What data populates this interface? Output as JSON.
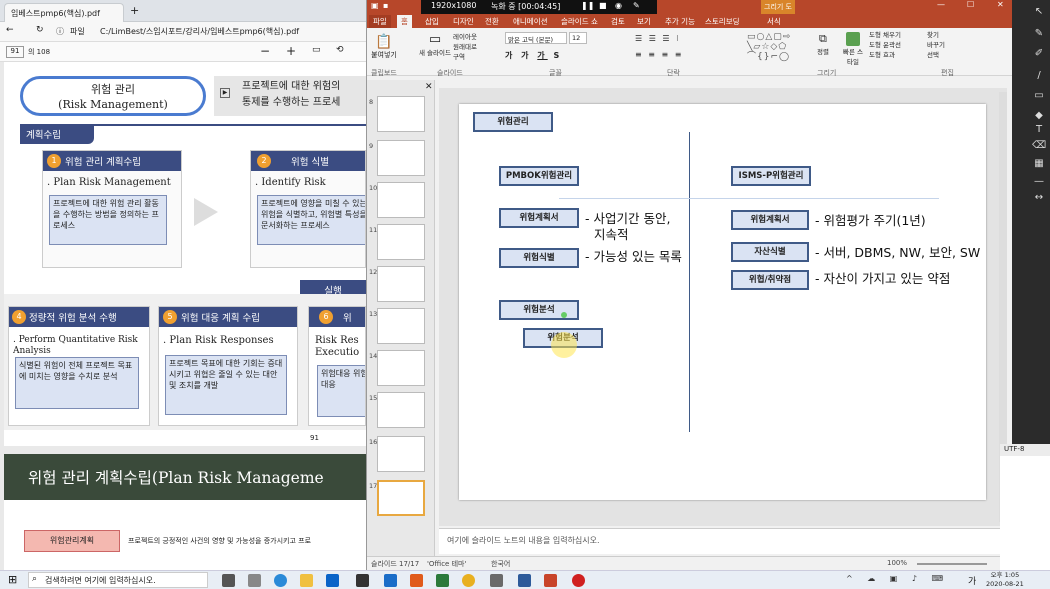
{
  "pdf": {
    "tab_title": "임베스트pmp6(핵심).pdf",
    "address_label": "파일",
    "address_path": "C:/LimBest/스임시포트/강리사/임베스트pmp6(핵심).pdf",
    "page_current": "91",
    "page_total": "의 108",
    "top_title": "위험 관리",
    "top_title_en": "(Risk Management)",
    "top_desc_line1": "프로젝트에 대한 위험의",
    "top_desc_line2": "통제를 수행하는 프로세",
    "badge_plan": "계획수립",
    "p1_header": "위험 관리 계획수립",
    "p1_num": "1",
    "p1_sub": ". Plan Risk Management",
    "p1_body": "프로젝트에 대한 위험 관리 활동을 수행하는 방법을 정의하는 프로세스",
    "p2_header": "위험 식별",
    "p2_num": "2",
    "p2_sub": ". Identify Risk",
    "p2_body": "프로젝트에 영향을 미칠 수 있는 위험을 식별하고, 위험별 특성을 문서화하는 프로세스",
    "badge_exec": "실행",
    "p4_header": "정량적 위험 분석 수행",
    "p4_num": "4",
    "p4_sub": ". Perform Quantitative Risk Analysis",
    "p4_body": "식별된 위험이 전체 프로젝트 목표에 미치는 영향을 수치로 분석",
    "p5_header": "위험 대응 계획 수립",
    "p5_num": "5",
    "p5_sub": ". Plan Risk Responses",
    "p5_body": "프로젝트 목표에 대한 기회는 증대시키고 위협은 줄일 수 있는 대안 및 조치를 개발",
    "p6_header": "위",
    "p6_num": "6",
    "p6_sub": "Risk Res Executio",
    "p6_body": "위험대응 위험대응",
    "page_number": "91",
    "next_title": "위험 관리 계획수립(Plan Risk Manageme",
    "next_badge": "위험관리계획",
    "next_desc": "프로젝트의 긍정적인 사건의 영향 및 가능성을 증가시키고 프로"
  },
  "ppt": {
    "resolution": "1920x1080",
    "recording": "녹화 중 [00:04:45]",
    "context_tab": "그리기 도구",
    "tabs": [
      "파일",
      "홈",
      "삽입",
      "디자인",
      "전환",
      "애니메이션",
      "슬라이드 쇼",
      "검토",
      "보기",
      "추가 기능",
      "스토리보딩",
      "서식"
    ],
    "groups": [
      "클립보드",
      "슬라이드",
      "글꼴",
      "단락",
      "그리기",
      "편집"
    ],
    "font_name": "맑은 고딕 (본문)",
    "font_size": "12",
    "ribbon_new_slide": "새 슬라이드",
    "ribbon_layout": "레이아웃",
    "ribbon_reset": "원래대로",
    "ribbon_section": "구역",
    "ribbon_paste": "붙여넣기",
    "ribbon_arrange": "정렬",
    "ribbon_quickstyle": "빠른 스타일",
    "ribbon_fill": "도형 채우기",
    "ribbon_outline": "도형 윤곽선",
    "ribbon_effect": "도형 효과",
    "ribbon_find": "찾기",
    "ribbon_replace": "바꾸기",
    "ribbon_select": "선택",
    "thumb_numbers": [
      "8",
      "9",
      "10",
      "11",
      "12",
      "13",
      "14",
      "15",
      "16",
      "17"
    ],
    "slide": {
      "title_box": "위험관리",
      "left_header": "PMBOK위험관리",
      "right_header": "ISMS-P위험관리",
      "l1_box": "위험계획서",
      "l1_text": "- 사업기간 동안,",
      "l1_text2": "지속적",
      "l2_box": "위험식별",
      "l2_text": "- 가능성 있는 목록",
      "l3_box": "위험분석",
      "l4_box": "위험분석",
      "r1_box": "위험계획서",
      "r1_text": "- 위험평가 주기(1년)",
      "r2_box": "자산식별",
      "r2_text": "- 서버, DBMS, NW, 보안, SW",
      "r3_box": "위협/취약점",
      "r3_text": "- 자산이 가지고 있는 약점"
    },
    "notes_placeholder": "여기에 슬라이드 노트의 내용을 입력하십시오.",
    "status_slide": "슬라이드 17/17",
    "status_theme": "'Office 테마'",
    "status_lang": "한국어",
    "zoom": "100%"
  },
  "right_panel": {
    "encoding": "UTF-8"
  },
  "taskbar": {
    "search_placeholder": "검색하려면 여기에 입력하십시오.",
    "time": "오후 1:05",
    "date": "2020-08-21",
    "ime": "가"
  }
}
